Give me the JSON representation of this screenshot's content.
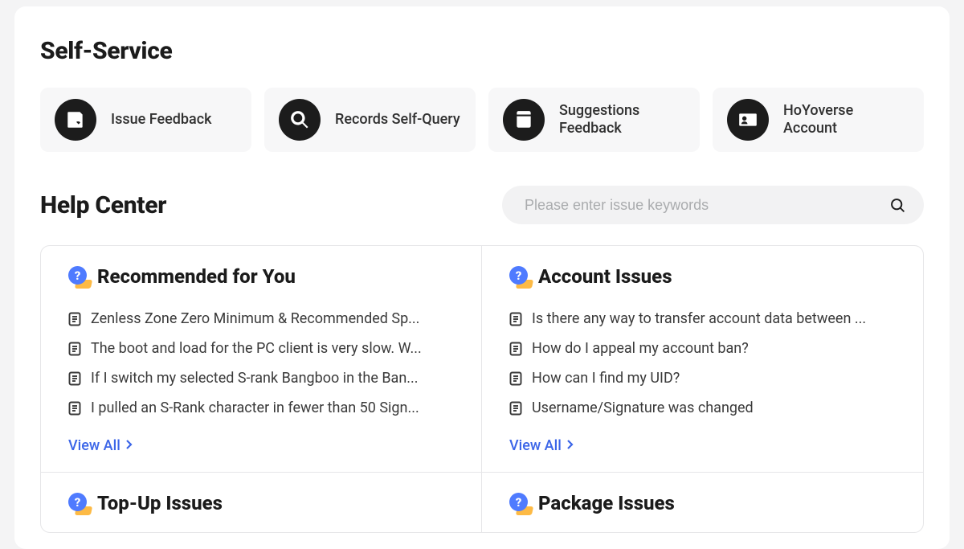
{
  "selfService": {
    "title": "Self-Service",
    "tiles": [
      {
        "label": "Issue Feedback",
        "icon": "feedback-icon"
      },
      {
        "label": "Records Self-Query",
        "icon": "search-icon"
      },
      {
        "label": "Suggestions Feedback",
        "icon": "suggestions-icon"
      },
      {
        "label": "HoYoverse Account",
        "icon": "account-icon"
      }
    ]
  },
  "helpCenter": {
    "title": "Help Center",
    "search": {
      "placeholder": "Please enter issue keywords",
      "value": ""
    },
    "viewAllLabel": "View All",
    "sections": [
      {
        "title": "Recommended for You",
        "items": [
          "Zenless Zone Zero Minimum & Recommended Sp...",
          "The boot and load for the PC client is very slow. W...",
          "If I switch my selected S-rank Bangboo in the Ban...",
          "I pulled an S-Rank character in fewer than 50 Sign..."
        ]
      },
      {
        "title": "Account Issues",
        "items": [
          "Is there any way to transfer account data between ...",
          "How do I appeal my account ban?",
          "How can I find my UID?",
          "Username/Signature was changed"
        ]
      },
      {
        "title": "Top-Up Issues",
        "items": []
      },
      {
        "title": "Package Issues",
        "items": []
      }
    ]
  }
}
